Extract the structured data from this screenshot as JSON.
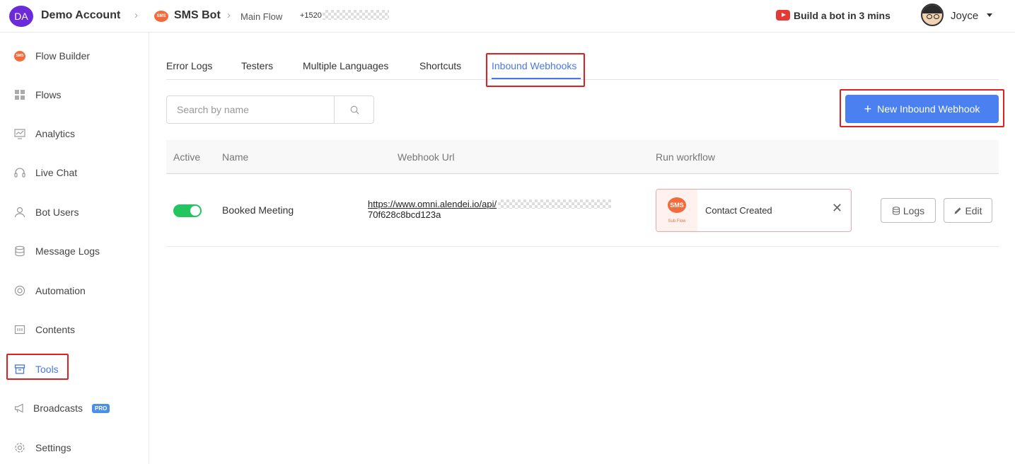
{
  "topbar": {
    "account_initials": "DA",
    "account_name": "Demo Account",
    "bot_badge": "SMS",
    "bot_name": "SMS Bot",
    "flow_name": "Main Flow",
    "phone_prefix": "+1520",
    "build_link": "Build a bot in 3 mins",
    "user_name": "Joyce"
  },
  "sidebar": {
    "items": [
      {
        "label": "Flow Builder",
        "icon": "sms-icon"
      },
      {
        "label": "Flows",
        "icon": "grid-icon"
      },
      {
        "label": "Analytics",
        "icon": "chart-icon"
      },
      {
        "label": "Live Chat",
        "icon": "headset-icon"
      },
      {
        "label": "Bot Users",
        "icon": "user-icon"
      },
      {
        "label": "Message Logs",
        "icon": "database-icon"
      },
      {
        "label": "Automation",
        "icon": "lifebuoy-icon"
      },
      {
        "label": "Contents",
        "icon": "content-icon"
      },
      {
        "label": "Tools",
        "icon": "toolbox-icon"
      },
      {
        "label": "Broadcasts",
        "icon": "megaphone-icon",
        "badge": "PRO"
      },
      {
        "label": "Settings",
        "icon": "gear-icon"
      }
    ],
    "active": "Tools"
  },
  "tabs": [
    {
      "label": "Error Logs"
    },
    {
      "label": "Testers"
    },
    {
      "label": "Multiple Languages"
    },
    {
      "label": "Shortcuts"
    },
    {
      "label": "Inbound Webhooks"
    }
  ],
  "active_tab": "Inbound Webhooks",
  "search": {
    "placeholder": "Search by name",
    "value": ""
  },
  "new_button": {
    "label": "New Inbound Webhook"
  },
  "table": {
    "headers": {
      "active": "Active",
      "name": "Name",
      "url": "Webhook Url",
      "workflow": "Run workflow"
    },
    "rows": [
      {
        "active": true,
        "name": "Booked Meeting",
        "url_line1": "https://www.omni.alendei.io/api/",
        "url_line2": "70f628c8bcd123a",
        "workflow_badge": "SMS",
        "workflow_type": "Sub Flow",
        "workflow_name": "Contact Created",
        "logs_label": "Logs",
        "edit_label": "Edit"
      }
    ]
  },
  "colors": {
    "accent": "#4a80f0",
    "highlight": "#e02020",
    "toggle_on": "#22c55e",
    "sms_brand": "#f26b3a"
  }
}
